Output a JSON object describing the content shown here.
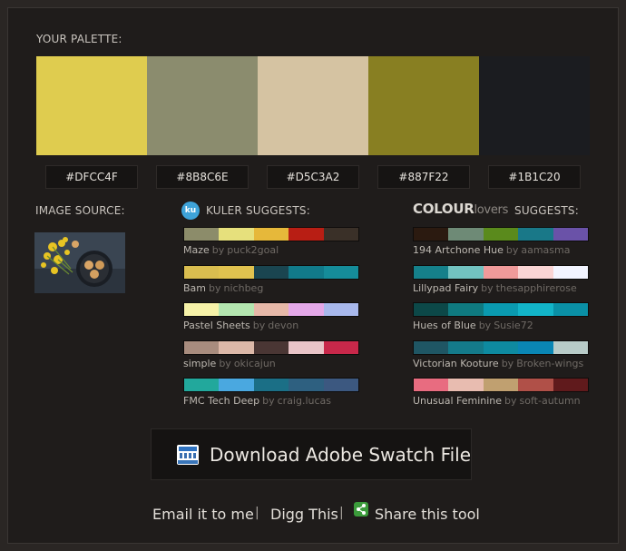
{
  "palette": {
    "heading": "YOUR PALETTE:",
    "swatches": [
      {
        "hex": "#DFCC4F",
        "color": "#dfcc4f"
      },
      {
        "hex": "#8B8C6E",
        "color": "#8b8c6e"
      },
      {
        "hex": "#D5C3A2",
        "color": "#d5c3a2"
      },
      {
        "hex": "#887F22",
        "color": "#887f22"
      },
      {
        "hex": "#1B1C20",
        "color": "#1b1c20"
      }
    ]
  },
  "image_source": {
    "heading": "IMAGE SOURCE:"
  },
  "kuler": {
    "logo_text": "ku",
    "heading": "KULER SUGGESTS:",
    "items": [
      {
        "title": "Maze",
        "by": "by",
        "author": "puck2goal",
        "colors": [
          "#8c8c6a",
          "#e6e07c",
          "#e6b83a",
          "#b81e14",
          "#3a3028"
        ]
      },
      {
        "title": "Bam",
        "by": "by",
        "author": "nichbeg",
        "colors": [
          "#d9bd4f",
          "#e0c24f",
          "#1a4550",
          "#117a8a",
          "#158c9a"
        ]
      },
      {
        "title": "Pastel Sheets",
        "by": "by",
        "author": "devon",
        "colors": [
          "#f6f2a8",
          "#b4e6b0",
          "#e6b8a8",
          "#e4a8e8",
          "#a8b8ec"
        ]
      },
      {
        "title": "simple",
        "by": "by",
        "author": "okicajun",
        "colors": [
          "#a88c7e",
          "#dcb8a8",
          "#4a3634",
          "#e8c4c8",
          "#c8284a"
        ]
      },
      {
        "title": "FMC Tech Deep",
        "by": "by",
        "author": "craig.lucas",
        "colors": [
          "#22a89c",
          "#4aa8e0",
          "#1b6f86",
          "#2e6080",
          "#3c5880"
        ]
      }
    ]
  },
  "colourlovers": {
    "logo_bold": "COLOUR",
    "logo_light": "lovers",
    "heading": "SUGGESTS:",
    "items": [
      {
        "title": "194 Artchone Hue",
        "by": "by",
        "author": "aamasma",
        "colors": [
          "#2b1a10",
          "#6e8a76",
          "#5a8a1c",
          "#197888",
          "#6a52a8"
        ]
      },
      {
        "title": "Lillypad Fairy",
        "by": "by",
        "author": "thesapphirerose",
        "colors": [
          "#15808a",
          "#72c2c0",
          "#ef9a9a",
          "#f9d4d4",
          "#f2f4ff"
        ]
      },
      {
        "title": "Hues of Blue",
        "by": "by",
        "author": "Susie72",
        "colors": [
          "#0c4848",
          "#0f7a80",
          "#0a9ab0",
          "#12b4c8",
          "#0a90a6"
        ]
      },
      {
        "title": "Victorian Kooture",
        "by": "by",
        "author": "Broken-wings",
        "colors": [
          "#1f5664",
          "#147a8a",
          "#0e8aa0",
          "#0a86b4",
          "#b8cbc8"
        ]
      },
      {
        "title": "Unusual Feminine",
        "by": "by",
        "author": "soft-autumn",
        "colors": [
          "#e86c80",
          "#e8bcb0",
          "#c0a070",
          "#b05048",
          "#601a1c"
        ]
      }
    ]
  },
  "download": {
    "label": "Download Adobe Swatch File",
    "icon": "swatch-file-icon"
  },
  "footer": {
    "email": "Email it to me",
    "digg": "Digg This",
    "share": "Share this tool",
    "separator": "|",
    "share_icon": "share-icon"
  }
}
